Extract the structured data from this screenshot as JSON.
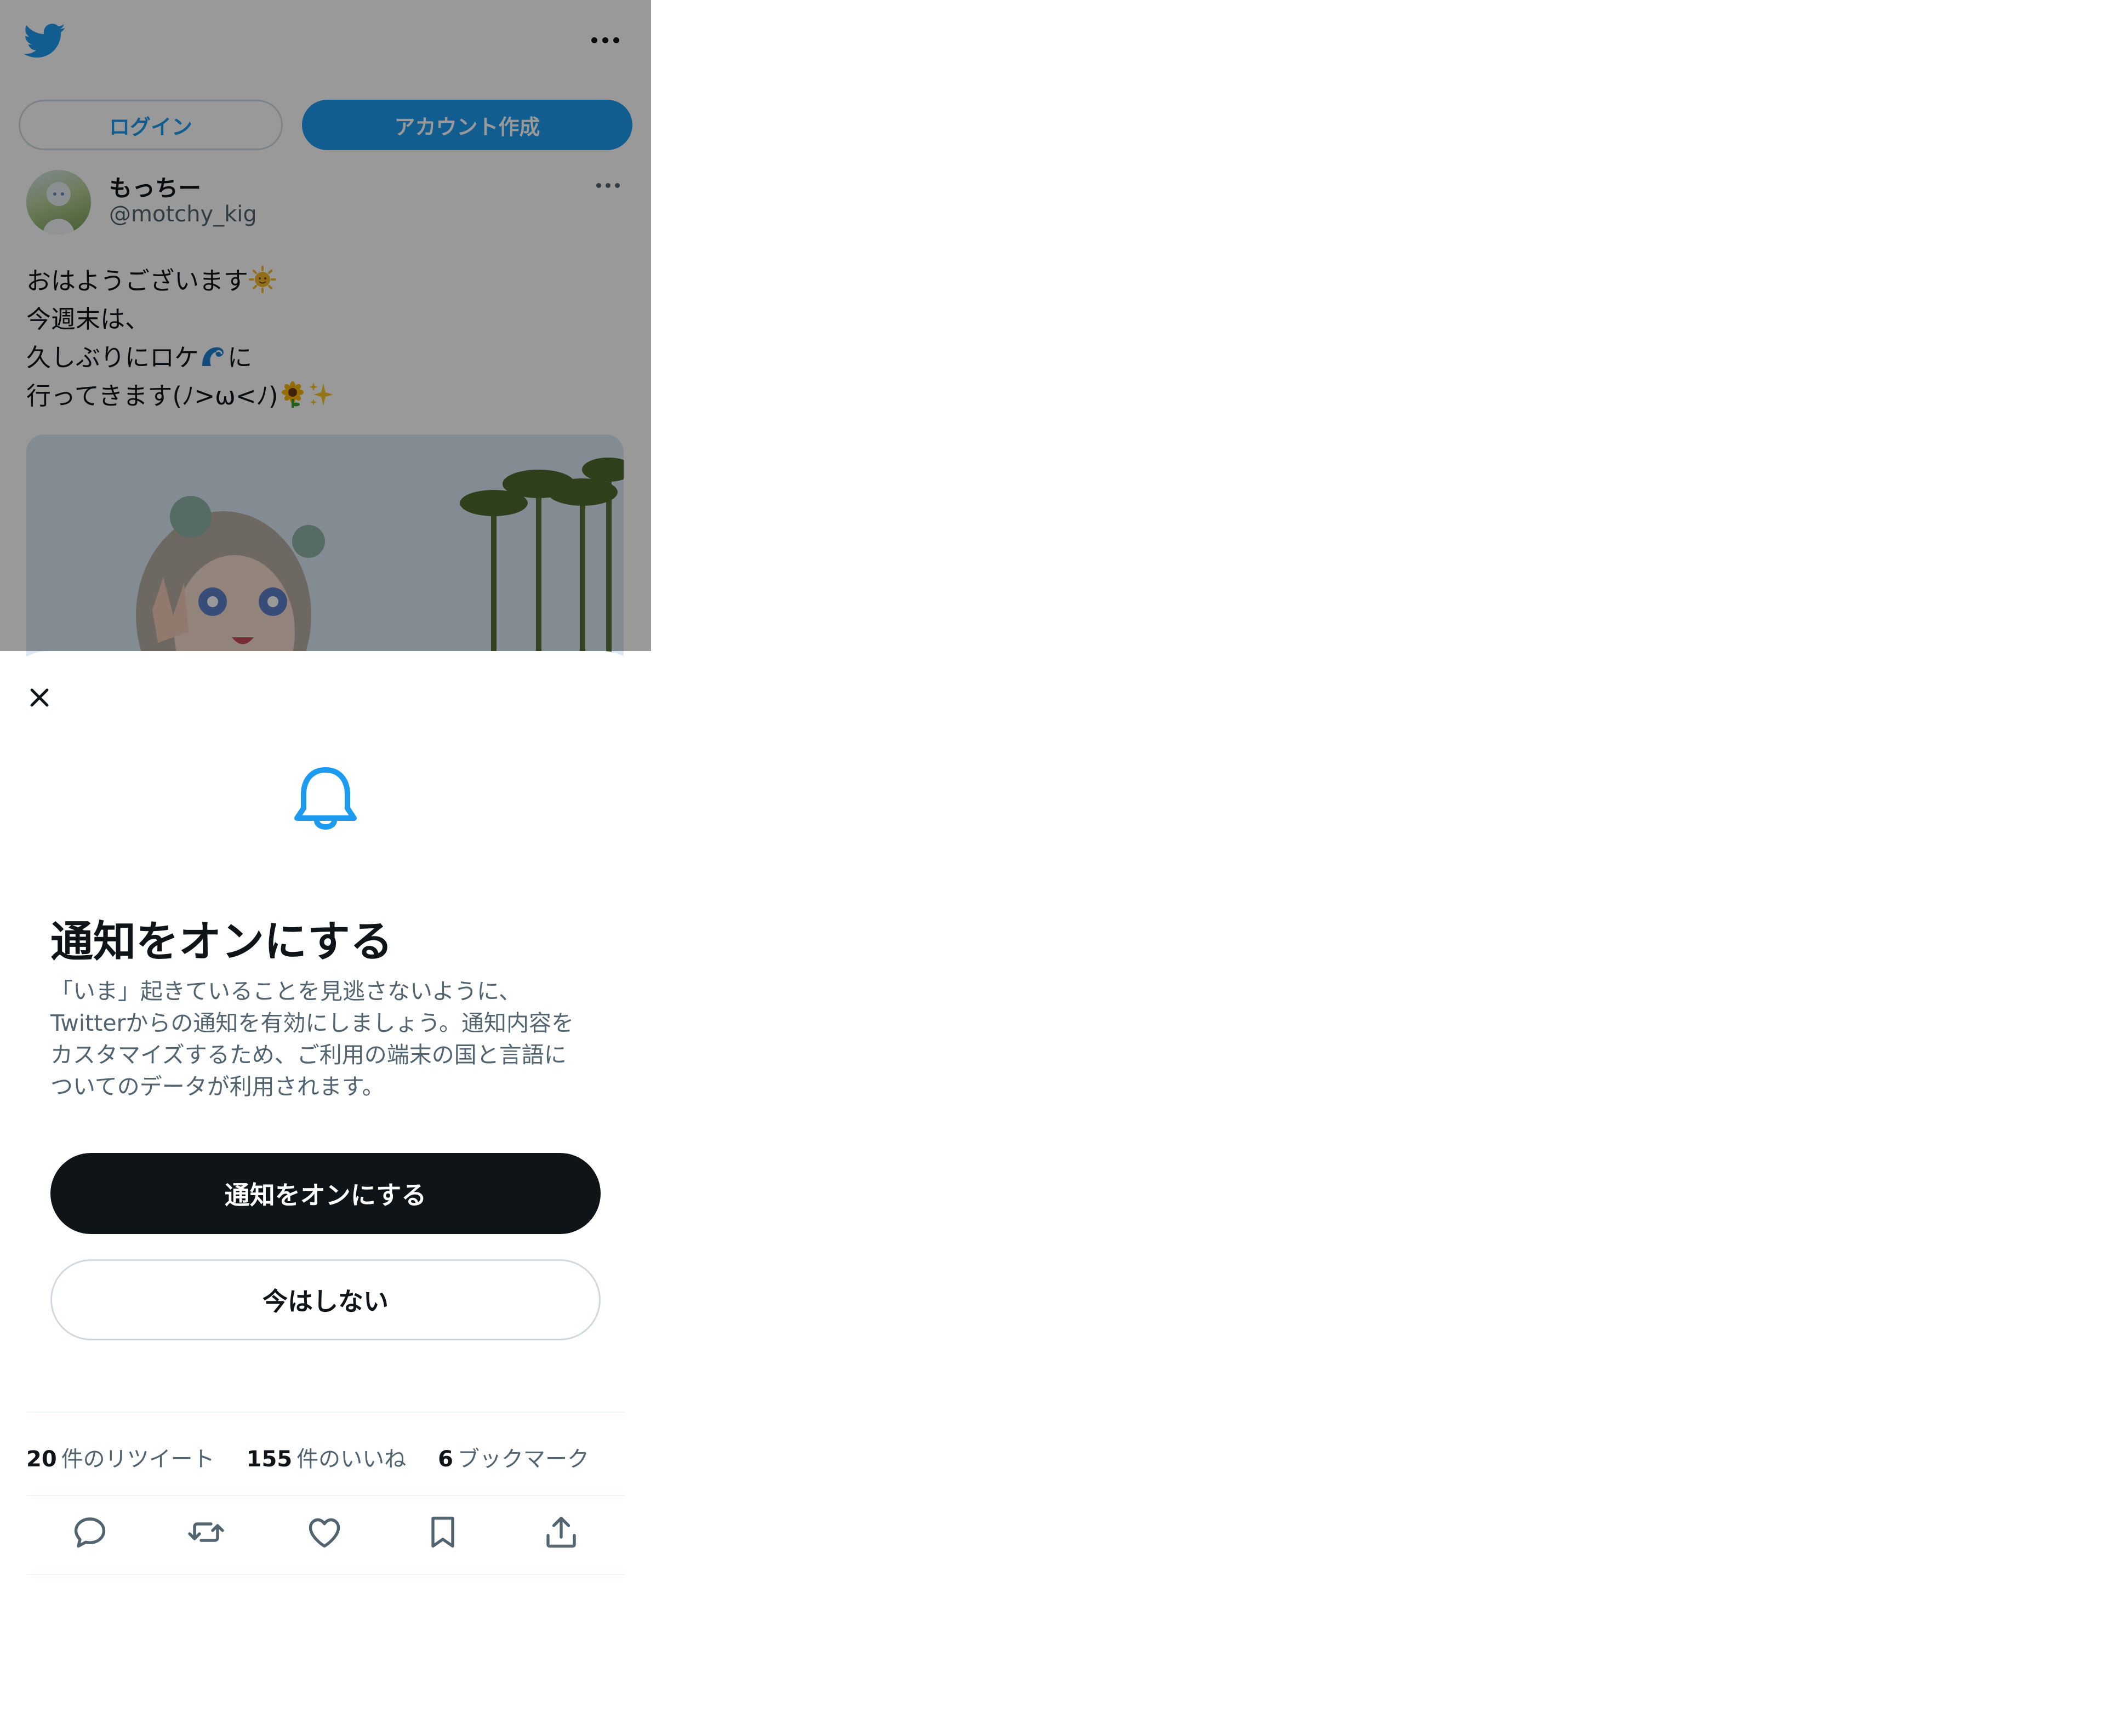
{
  "header": {
    "logo": "twitter-bird-icon",
    "menu": "more-icon"
  },
  "auth": {
    "login_label": "ログイン",
    "signup_label": "アカウント作成"
  },
  "tweet": {
    "user_name": "もっちー",
    "user_handle": "@motchy_kig",
    "text_lines": [
      {
        "text": "おはようございます",
        "emoji": [
          "sun-face-emoji"
        ]
      },
      {
        "text": "今週末は、"
      },
      {
        "text_before": "久しぶりにロケ",
        "emoji": [
          "wave-emoji"
        ],
        "text_after": "に"
      },
      {
        "text": "行ってきます(ﾉ>ω<ﾉ)",
        "emoji": [
          "sunflower-emoji",
          "sparkles-emoji"
        ]
      }
    ]
  },
  "modal": {
    "title": "通知をオンにする",
    "description_lines": [
      "「いま」起きていることを見逃さないように、",
      "Twitterからの通知を有効にしましょう。通知内容を",
      "カスタマイズするため、ご利用の端末の国と言語に",
      "ついてのデータが利用されます。"
    ],
    "primary_label": "通知をオンにする",
    "secondary_label": "今はしない"
  },
  "stats": {
    "retweets_count": "20",
    "retweets_label": "件のリツイート",
    "likes_count": "155",
    "likes_label": "件のいいね",
    "bookmarks_count": "6",
    "bookmarks_label": "ブックマーク"
  },
  "actions": [
    "reply-icon",
    "retweet-icon",
    "like-icon",
    "bookmark-icon",
    "share-icon"
  ],
  "colors": {
    "brand_blue": "#1d9bf0",
    "text_primary": "#0f1419",
    "text_secondary": "#536471",
    "border": "#cfd9de",
    "overlay": "rgba(0,0,0,0.40)"
  }
}
